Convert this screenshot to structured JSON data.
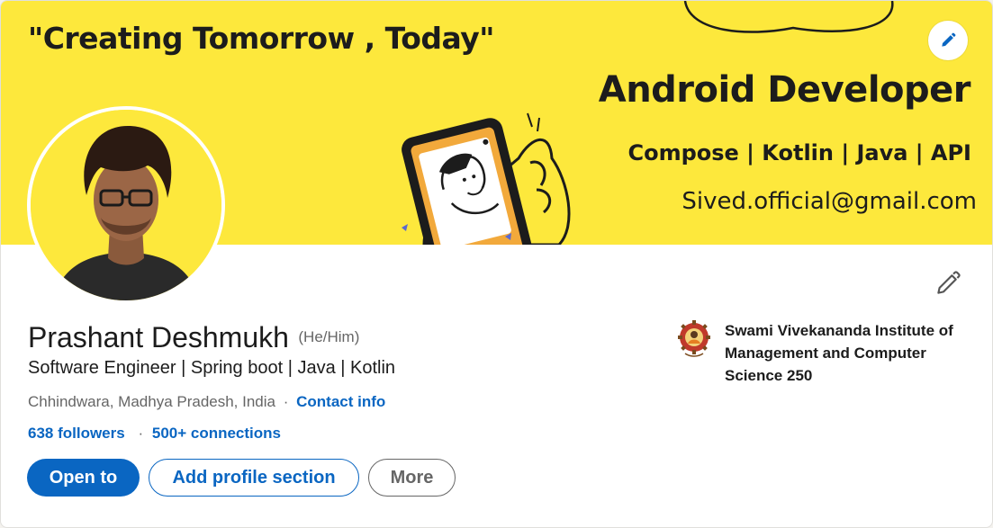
{
  "banner": {
    "quote": "\"Creating Tomorrow , Today\"",
    "title": "Android Developer",
    "skills": "Compose | Kotlin | Java | API",
    "email": "Sived.official@gmail.com",
    "background_color": "#fde83c"
  },
  "profile": {
    "name": "Prashant Deshmukh",
    "pronouns": "(He/Him)",
    "headline": "Software Engineer | Spring boot | Java | Kotlin",
    "location": "Chhindwara, Madhya Pradesh, India",
    "separator": "·",
    "contact_info_label": "Contact info",
    "followers_label": "638 followers",
    "connections_label": "500+ connections"
  },
  "actions": {
    "open_to": "Open to",
    "add_profile_section": "Add profile section",
    "more": "More"
  },
  "education": {
    "name": "Swami Vivekananda Institute of Management and Computer Science 250"
  },
  "icons": {
    "cover_edit": "pencil-icon",
    "intro_edit": "pencil-icon"
  },
  "colors": {
    "accent": "#0a66c2",
    "text_primary": "#1c1c1c",
    "text_secondary": "#666666"
  }
}
